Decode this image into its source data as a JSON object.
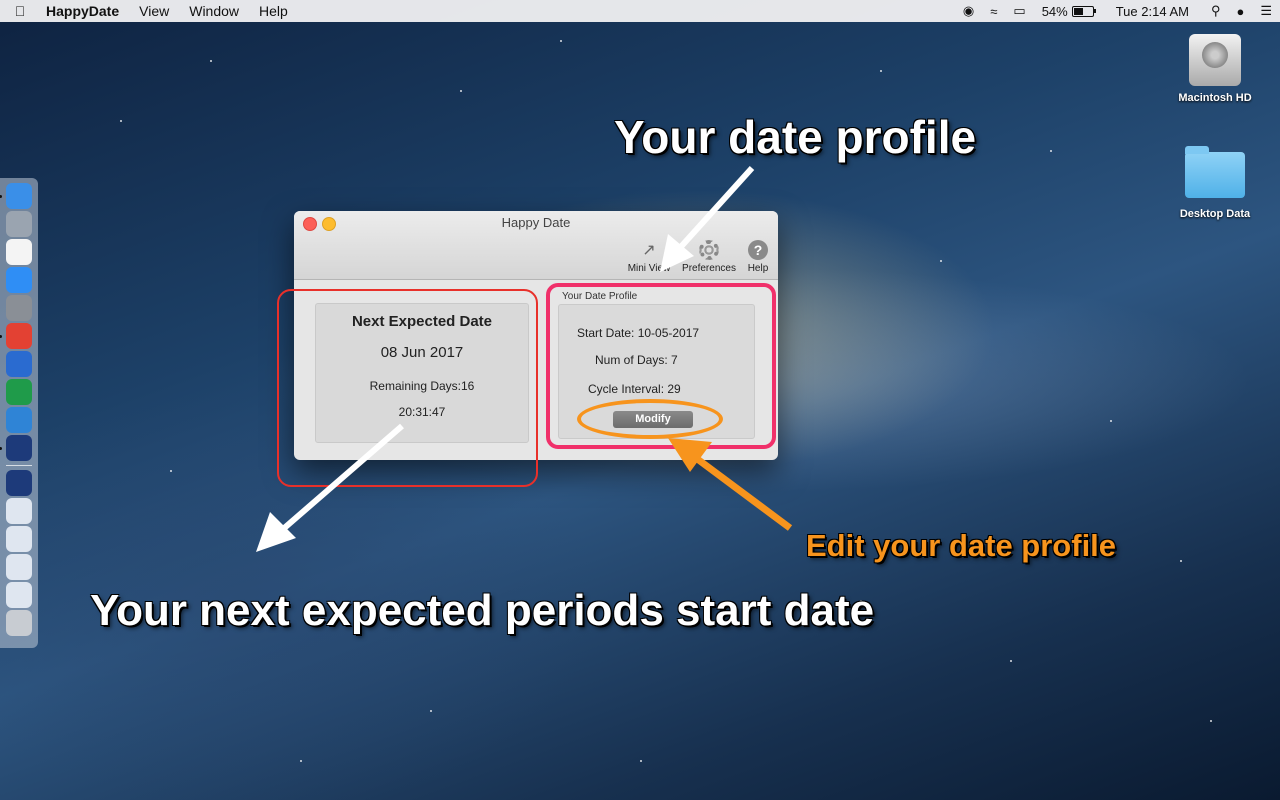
{
  "menubar": {
    "app_name": "HappyDate",
    "menus": [
      "View",
      "Window",
      "Help"
    ],
    "battery_percent": "54%",
    "clock": "Tue 2:14 AM",
    "battery_level": 0.54
  },
  "desktop": {
    "icons": [
      {
        "label": "Macintosh HD",
        "icon": "hard-drive-icon"
      },
      {
        "label": "Desktop Data",
        "icon": "folder-icon"
      }
    ]
  },
  "dock": {
    "items": [
      {
        "icon": "finder-icon",
        "color": "#3a8fe8"
      },
      {
        "icon": "launchpad-icon",
        "color": "#9aa4b0"
      },
      {
        "icon": "notes-icon",
        "color": "#f4f4f4"
      },
      {
        "icon": "app-store-icon",
        "color": "#2f8ef5"
      },
      {
        "icon": "system-preferences-icon",
        "color": "#8a8f96"
      },
      {
        "icon": "chrome-icon",
        "color": "#e34133"
      },
      {
        "icon": "word-icon",
        "color": "#2a6bd0"
      },
      {
        "icon": "excel-icon",
        "color": "#1f9b4a"
      },
      {
        "icon": "xcode-icon",
        "color": "#2f84d6"
      },
      {
        "icon": "happydate-icon",
        "color": "#1d3a7a"
      },
      {
        "icon": "happydate-window-icon",
        "color": "#1d3a7a"
      },
      {
        "icon": "window-thumbnail-icon",
        "color": "#dfe6f0"
      },
      {
        "icon": "window-thumbnail-icon",
        "color": "#dfe6f0"
      },
      {
        "icon": "window-thumbnail-icon",
        "color": "#dfe6f0"
      },
      {
        "icon": "window-thumbnail-icon",
        "color": "#dfe6f0"
      },
      {
        "icon": "trash-icon",
        "color": "#c8ccd2"
      }
    ]
  },
  "window": {
    "title": "Happy Date",
    "toolbar": {
      "mini_view": "Mini View",
      "preferences": "Preferences",
      "help": "Help"
    },
    "next_expected": {
      "heading": "Next Expected Date",
      "date": "08 Jun 2017",
      "remaining": "Remaining Days:16",
      "countdown": "20:31:47"
    },
    "profile": {
      "group_label": "Your Date Profile",
      "start_date": "Start Date: 10-05-2017",
      "num_days": "Num of Days: 7",
      "cycle_interval": "Cycle Interval: 29",
      "modify_label": "Modify"
    }
  },
  "annotations": {
    "profile_callout": "Your date profile",
    "edit_callout": "Edit your date profile",
    "next_callout": "Your next expected periods start date",
    "colors": {
      "red": "#e8302a",
      "pink": "#f0306a",
      "orange": "#f7941d",
      "white": "#ffffff"
    }
  }
}
